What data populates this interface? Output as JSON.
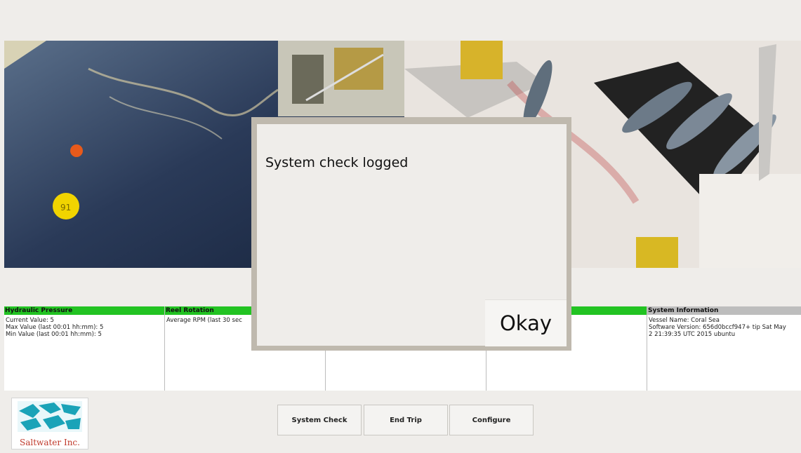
{
  "modal": {
    "message": "System check logged",
    "okay_label": "Okay"
  },
  "panels": [
    {
      "title": "Hydraulic Pressure",
      "status_color": "#22c322",
      "lines": "Current Value: 5\nMax Value (last 00:01 hh:mm): 5\nMin Value (last 00:01 hh:mm): 5"
    },
    {
      "title": "Reel Rotation",
      "status_color": "#22c322",
      "lines": "Average RPM (last 30 sec"
    },
    {
      "title": "",
      "status_color": "#22c322",
      "lines": ""
    },
    {
      "title": "",
      "status_color": "#22c322",
      "lines": "              %\n              %"
    },
    {
      "title": "System Information",
      "status_color": "#bdbdbd",
      "lines": "Vessel Name: Coral Sea\nSoftware Version: 656d0bccf947+ tip Sat May\n2 21:39:35 UTC 2015 ubuntu"
    }
  ],
  "footer": {
    "logo_text": "Saltwater Inc.",
    "buttons": {
      "system_check": "System Check",
      "end_trip": "End Trip",
      "configure": "Configure"
    }
  }
}
